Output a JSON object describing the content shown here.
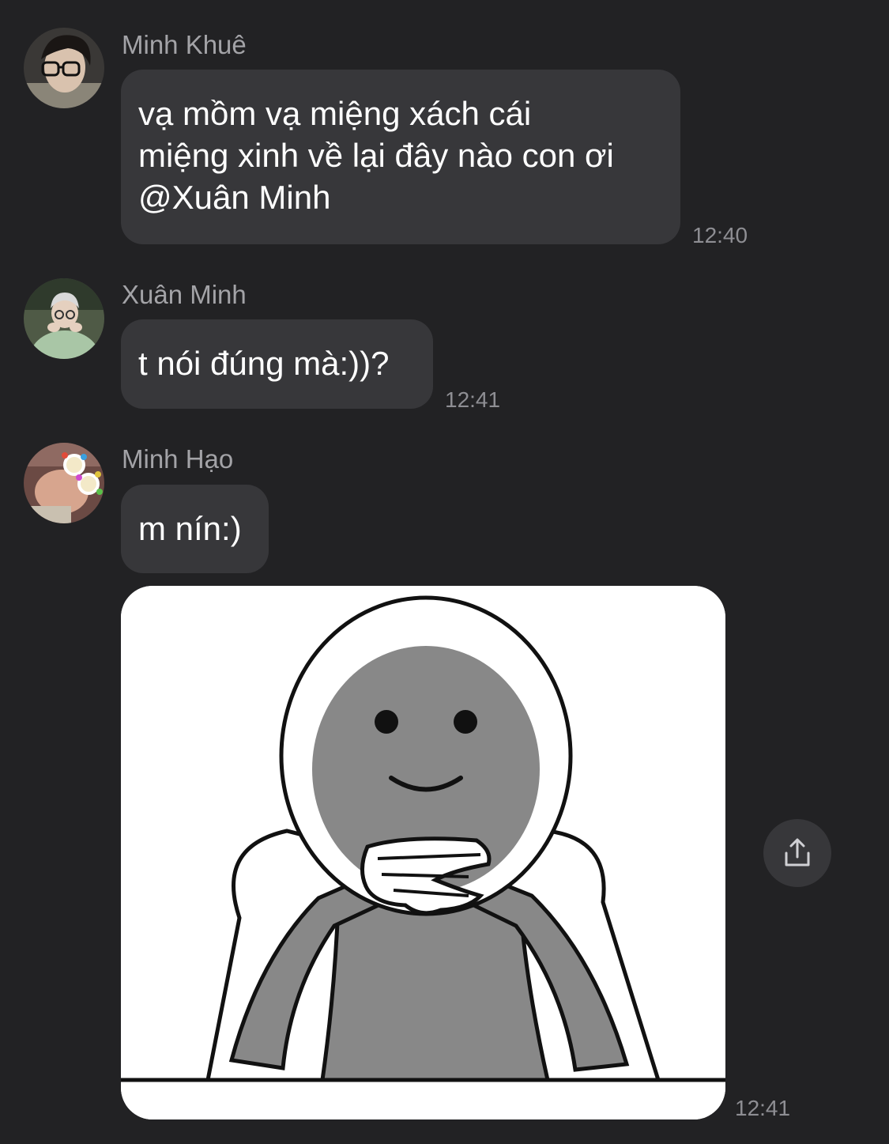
{
  "messages": [
    {
      "sender": "Minh Khuê",
      "lines": [
        "vạ mồm vạ miệng xách cái",
        "miệng xinh về lại đây nào con ơi",
        "@Xuân Minh"
      ],
      "time": "12:40"
    },
    {
      "sender": "Xuân Minh",
      "lines": [
        "t nói đúng mà:))?"
      ],
      "time": "12:41"
    },
    {
      "sender": "Minh Hạo",
      "lines": [
        "m nín:)"
      ],
      "sticker_time": "12:41"
    }
  ],
  "icons": {
    "share": "share-icon"
  },
  "colors": {
    "background": "#222224",
    "bubble": "#37373a",
    "sender_text": "#a3a3a7",
    "time_text": "#8e8e93"
  }
}
